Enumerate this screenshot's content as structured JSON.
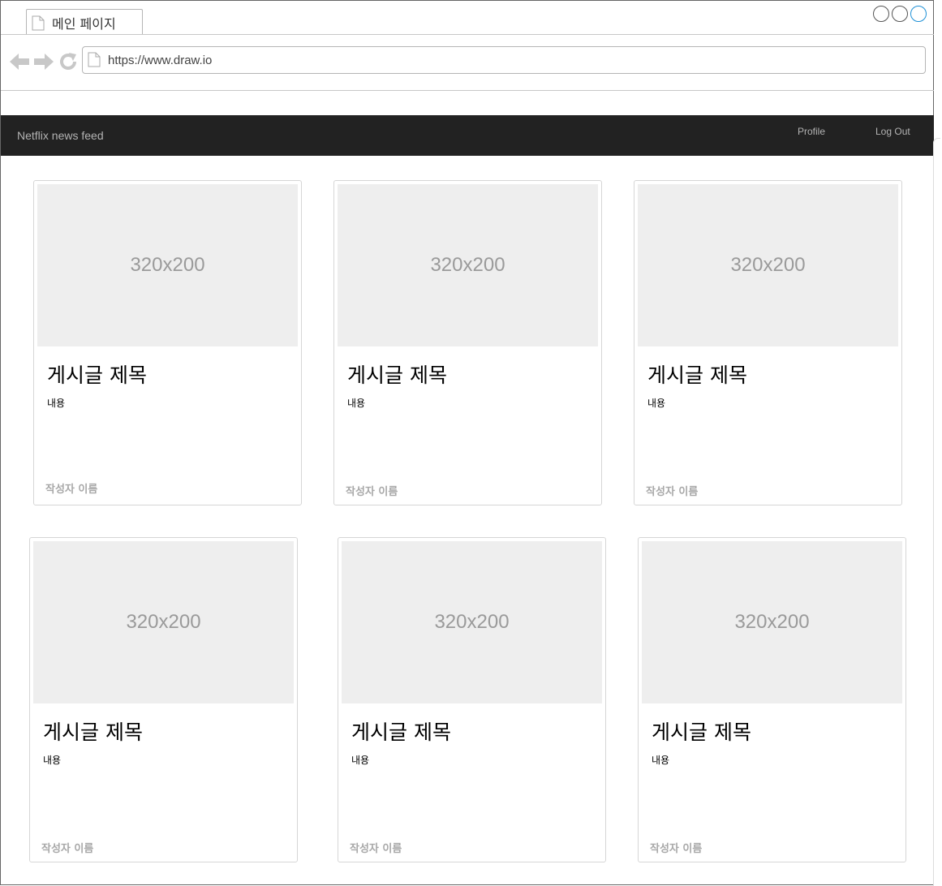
{
  "browser": {
    "tab_title": "메인 페이지",
    "url": "https://www.draw.io"
  },
  "navbar": {
    "brand": "Netflix news feed",
    "profile_label": "Profile",
    "logout_label": "Log Out"
  },
  "posts": [
    {
      "image_label": "320x200",
      "title": "게시글 제목",
      "content": "내용",
      "author": "작성자 이름"
    },
    {
      "image_label": "320x200",
      "title": "게시글 제목",
      "content": "내용",
      "author": "작성자 이름"
    },
    {
      "image_label": "320x200",
      "title": "게시글 제목",
      "content": "내용",
      "author": "작성자 이름"
    },
    {
      "image_label": "320x200",
      "title": "게시글 제목",
      "content": "내용",
      "author": "작성자 이름"
    },
    {
      "image_label": "320x200",
      "title": "게시글 제목",
      "content": "내용",
      "author": "작성자 이름"
    },
    {
      "image_label": "320x200",
      "title": "게시글 제목",
      "content": "내용",
      "author": "작성자 이름"
    }
  ],
  "icons": {
    "back": "arrow-left-icon",
    "forward": "arrow-right-icon",
    "reload": "refresh-icon",
    "page": "document-icon"
  },
  "colors": {
    "navbar_bg": "#222222",
    "navbar_text": "#b3b3b3",
    "placeholder_bg": "#eeeeee",
    "author_text": "#a8a8a8",
    "active_window_button": "#1e90d6"
  }
}
